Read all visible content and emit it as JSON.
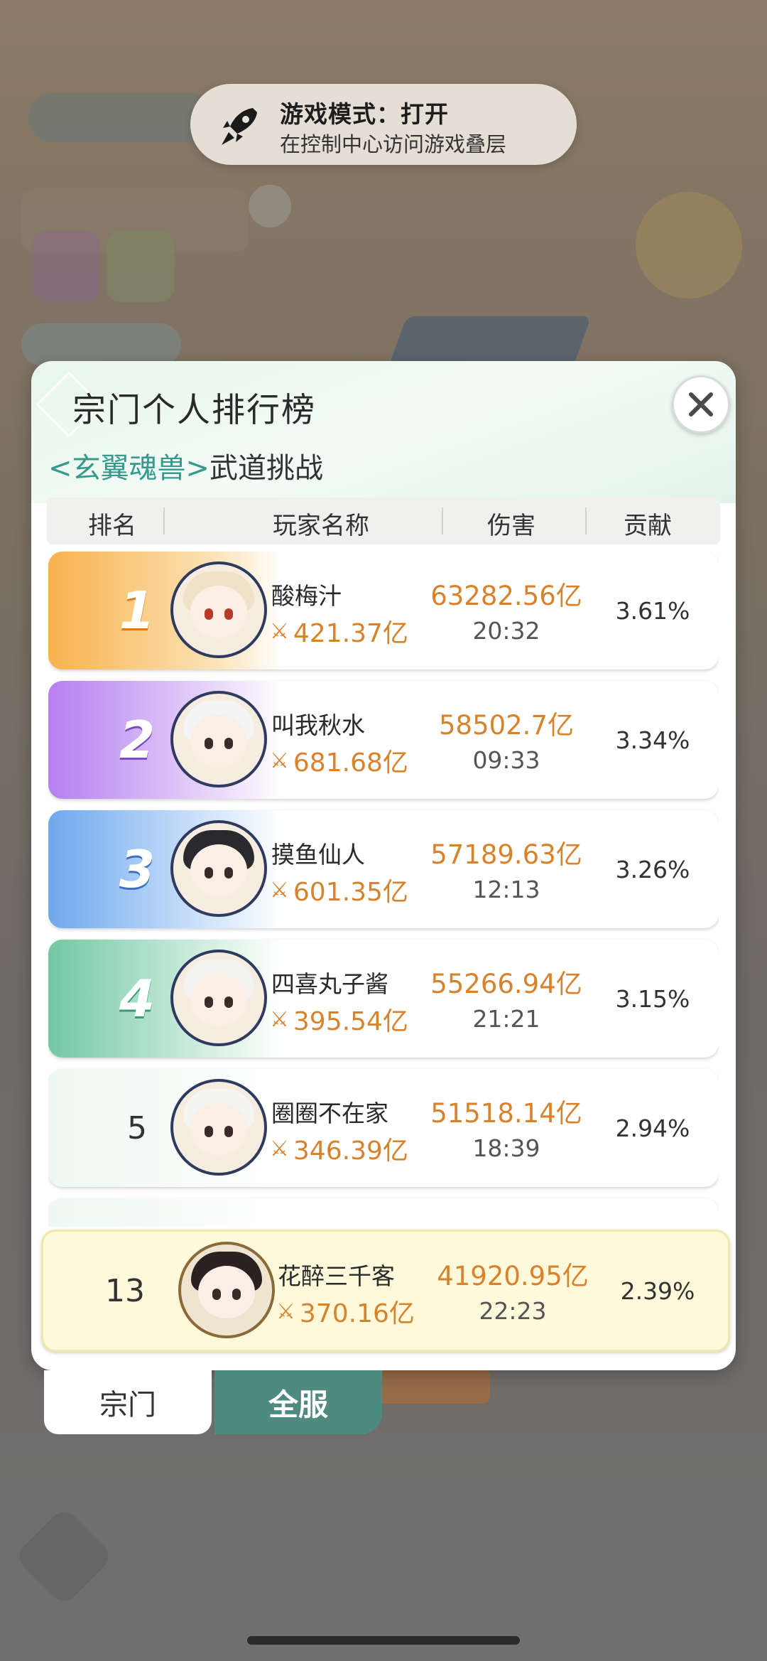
{
  "toast": {
    "title": "游戏模式：打开",
    "subtitle": "在控制中心访问游戏叠层",
    "icon": "rocket-icon"
  },
  "panel": {
    "title": "宗门个人排行榜",
    "subtitle_tag": "<玄翼魂兽>",
    "subtitle_rest": "武道挑战",
    "close_icon": "close-icon"
  },
  "columns": [
    "排名",
    "玩家名称",
    "伤害",
    "贡献"
  ],
  "rows": [
    {
      "rank": "1",
      "name": "酸梅汁",
      "power": "421.37亿",
      "damage": "63282.56亿",
      "time": "20:32",
      "contrib": "3.61%"
    },
    {
      "rank": "2",
      "name": "叫我秋水",
      "power": "681.68亿",
      "damage": "58502.7亿",
      "time": "09:33",
      "contrib": "3.34%"
    },
    {
      "rank": "3",
      "name": "摸鱼仙人",
      "power": "601.35亿",
      "damage": "57189.63亿",
      "time": "12:13",
      "contrib": "3.26%"
    },
    {
      "rank": "4",
      "name": "四喜丸子酱",
      "power": "395.54亿",
      "damage": "55266.94亿",
      "time": "21:21",
      "contrib": "3.15%"
    },
    {
      "rank": "5",
      "name": "圈圈不在家",
      "power": "346.39亿",
      "damage": "51518.14亿",
      "time": "18:39",
      "contrib": "2.94%"
    }
  ],
  "self": {
    "rank": "13",
    "name": "花醉三千客",
    "power": "370.16亿",
    "damage": "41920.95亿",
    "time": "22:23",
    "contrib": "2.39%"
  },
  "tabs": {
    "sect": "宗门",
    "all": "全服"
  },
  "colors": {
    "rank1": "#f6b14a",
    "rank2": "#b07ae8",
    "rank3": "#6aa6ea",
    "rank4": "#6cc7a0",
    "accent_teal": "#36998c",
    "damage_orange": "#d8822c",
    "tab_active": "#4e8a80"
  }
}
